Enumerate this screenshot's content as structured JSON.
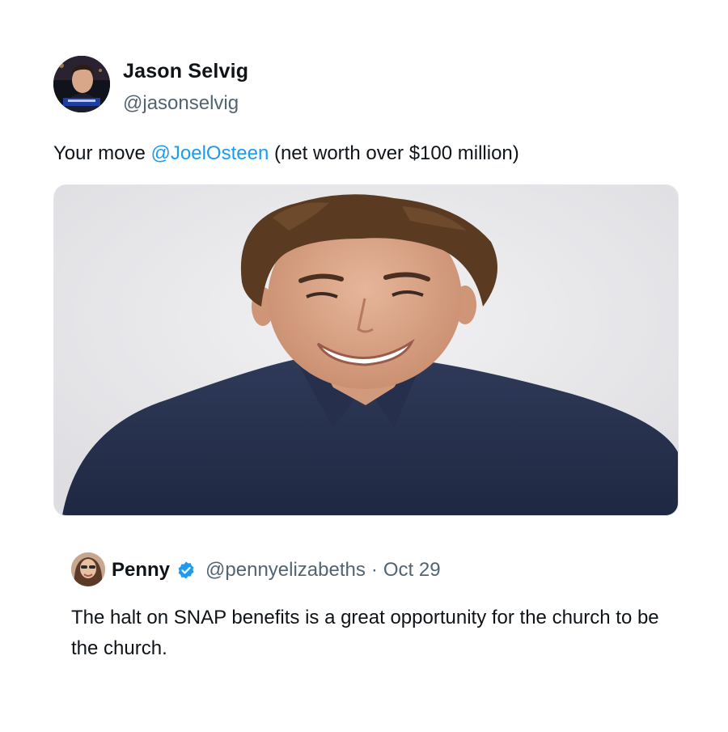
{
  "tweet": {
    "author_name": "Jason Selvig",
    "author_handle": "@jasonselvig",
    "text_prefix": "Your move ",
    "mention": "@JoelOsteen",
    "text_suffix": " (net worth over $100 million)",
    "media_icon": "photo-portrait"
  },
  "quoted": {
    "author_name": "Penny",
    "verified": true,
    "author_handle": "@pennyelizabeths",
    "separator": "·",
    "date": "Oct 29",
    "text": "The halt on SNAP benefits is a great opportunity for the church to be the church."
  },
  "colors": {
    "link": "#1d9bf0",
    "secondary_text": "#536471",
    "verified_badge": "#1d9bf0"
  }
}
